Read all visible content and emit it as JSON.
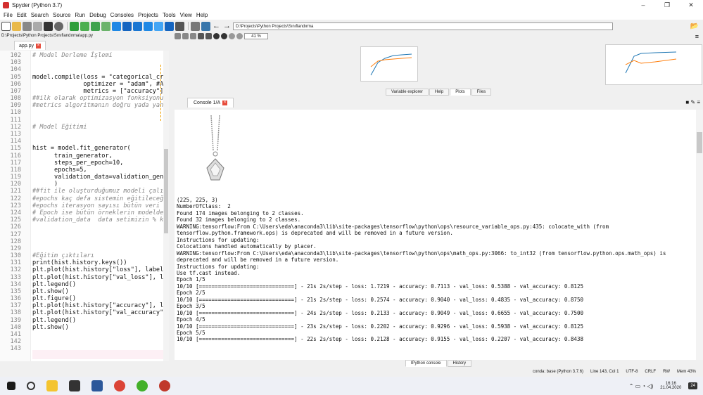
{
  "window": {
    "title": "Spyder (Python 3.7)",
    "min": "–",
    "max": "❐",
    "close": "✕"
  },
  "menu": [
    "File",
    "Edit",
    "Search",
    "Source",
    "Run",
    "Debug",
    "Consoles",
    "Projects",
    "Tools",
    "View",
    "Help"
  ],
  "toolbar": {
    "path": "D:\\Projects\\Python Projects\\Sınıflandırma"
  },
  "plot_toolbar": {
    "zoom": "41 %"
  },
  "editor": {
    "file_path": "D:\\Projects\\Python Projects\\Sınıflandırma\\app.py",
    "tab": "app.py",
    "lines": [
      {
        "n": "102",
        "t": "# Model Derleme İşlemi",
        "c": "cm"
      },
      {
        "n": "103",
        "t": "",
        "c": ""
      },
      {
        "n": "104",
        "t": "",
        "c": ""
      },
      {
        "n": "105",
        "t": "model.compile(loss = \"categorical_cross",
        "c": ""
      },
      {
        "n": "106",
        "t": "              optimizer = \"adam\", #Ağır",
        "c": ""
      },
      {
        "n": "107",
        "t": "              metrics = [\"accuracy\"])",
        "c": ""
      },
      {
        "n": "108",
        "t": "##ilk olarak optimizasyon fonksiyonumuz",
        "c": "cm"
      },
      {
        "n": "109",
        "t": "#metrics algoritmanın doğru yada yanlış",
        "c": "cm"
      },
      {
        "n": "110",
        "t": "",
        "c": ""
      },
      {
        "n": "111",
        "t": "",
        "c": ""
      },
      {
        "n": "112",
        "t": "# Model Eğitimi",
        "c": "cm"
      },
      {
        "n": "113",
        "t": "",
        "c": ""
      },
      {
        "n": "114",
        "t": "",
        "c": ""
      },
      {
        "n": "115",
        "t": "hist = model.fit_generator(",
        "c": ""
      },
      {
        "n": "116",
        "t": "      train_generator,",
        "c": ""
      },
      {
        "n": "117",
        "t": "      steps_per_epoch=10,",
        "c": ""
      },
      {
        "n": "118",
        "t": "      epochs=5,",
        "c": ""
      },
      {
        "n": "119",
        "t": "      validation_data=validation_genera",
        "c": ""
      },
      {
        "n": "120",
        "t": "      )",
        "c": ""
      },
      {
        "n": "121",
        "t": "##fit ile oluşturduğumuz modeli çalıştı",
        "c": "cm"
      },
      {
        "n": "122",
        "t": "#epochs kaç defa sistemin eğitileceği",
        "c": "cm"
      },
      {
        "n": "123",
        "t": "#epochs iterasyon sayısı bütün veri set",
        "c": "cm"
      },
      {
        "n": "124",
        "t": "# Epoch ise bütün örneklerin modelden k",
        "c": "cm"
      },
      {
        "n": "125",
        "t": "#validation_data  data setimizin % kaçı",
        "c": "cm"
      },
      {
        "n": "126",
        "t": "",
        "c": ""
      },
      {
        "n": "127",
        "t": "",
        "c": ""
      },
      {
        "n": "128",
        "t": "",
        "c": ""
      },
      {
        "n": "129",
        "t": "",
        "c": ""
      },
      {
        "n": "130",
        "t": "#Eğitim çıktıları",
        "c": "cm"
      },
      {
        "n": "131",
        "t": "print(hist.history.keys())",
        "c": ""
      },
      {
        "n": "132",
        "t": "plt.plot(hist.history[\"loss\"], label =",
        "c": ""
      },
      {
        "n": "133",
        "t": "plt.plot(hist.history[\"val_loss\"], labe",
        "c": ""
      },
      {
        "n": "134",
        "t": "plt.legend()",
        "c": ""
      },
      {
        "n": "135",
        "t": "plt.show()",
        "c": ""
      },
      {
        "n": "136",
        "t": "plt.figure()",
        "c": ""
      },
      {
        "n": "137",
        "t": "plt.plot(hist.history[\"accuracy\"], labe",
        "c": ""
      },
      {
        "n": "138",
        "t": "plt.plot(hist.history[\"val_accuracy\"],",
        "c": ""
      },
      {
        "n": "139",
        "t": "plt.legend()",
        "c": ""
      },
      {
        "n": "140",
        "t": "plt.show()",
        "c": ""
      },
      {
        "n": "141",
        "t": "",
        "c": ""
      },
      {
        "n": "142",
        "t": "",
        "c": ""
      },
      {
        "n": "143",
        "t": "",
        "c": ""
      }
    ]
  },
  "plot_tabs": [
    "Variable explorer",
    "Help",
    "Plots",
    "Files"
  ],
  "plot_tab_active": "Plots",
  "console": {
    "tab": "Console 1/A",
    "lines": [
      "(225, 225, 3)",
      "NumberOfClass:  2",
      "Found 174 images belonging to 2 classes.",
      "Found 32 images belonging to 2 classes.",
      "WARNING:tensorflow:From C:\\Users\\eda\\anaconda3\\lib\\site-packages\\tensorflow\\python\\ops\\resource_variable_ops.py:435: colocate_with (from",
      "tensorflow.python.framework.ops) is deprecated and will be removed in a future version.",
      "Instructions for updating:",
      "Colocations handled automatically by placer.",
      "WARNING:tensorflow:From C:\\Users\\eda\\anaconda3\\lib\\site-packages\\tensorflow\\python\\ops\\math_ops.py:3066: to_int32 (from tensorflow.python.ops.math_ops) is",
      "deprecated and will be removed in a future version.",
      "Instructions for updating:",
      "Use tf.cast instead.",
      "Epoch 1/5",
      "10/10 [==============================] - 21s 2s/step - loss: 1.7219 - accuracy: 0.7113 - val_loss: 0.5388 - val_accuracy: 0.8125",
      "Epoch 2/5",
      "10/10 [==============================] - 21s 2s/step - loss: 0.2574 - accuracy: 0.9040 - val_loss: 0.4835 - val_accuracy: 0.8750",
      "Epoch 3/5",
      "10/10 [==============================] - 24s 2s/step - loss: 0.2133 - accuracy: 0.9049 - val_loss: 0.6655 - val_accuracy: 0.7500",
      "Epoch 4/5",
      "10/10 [==============================] - 23s 2s/step - loss: 0.2202 - accuracy: 0.9296 - val_loss: 0.5938 - val_accuracy: 0.8125",
      "Epoch 5/5",
      "10/10 [==============================] - 22s 2s/step - loss: 0.2128 - accuracy: 0.9155 - val_loss: 0.2207 - val_accuracy: 0.8438"
    ]
  },
  "bottom_tabs": [
    "IPython console",
    "History"
  ],
  "status": {
    "conda": "conda: base (Python 3.7.6)",
    "pos": "Line 143, Col 1",
    "enc": "UTF-8",
    "eol": "CRLF",
    "rw": "RW",
    "mem": "Mem 43%"
  },
  "taskbar": {
    "time": "16:16",
    "date": "21.04.2020",
    "notif": "24"
  }
}
